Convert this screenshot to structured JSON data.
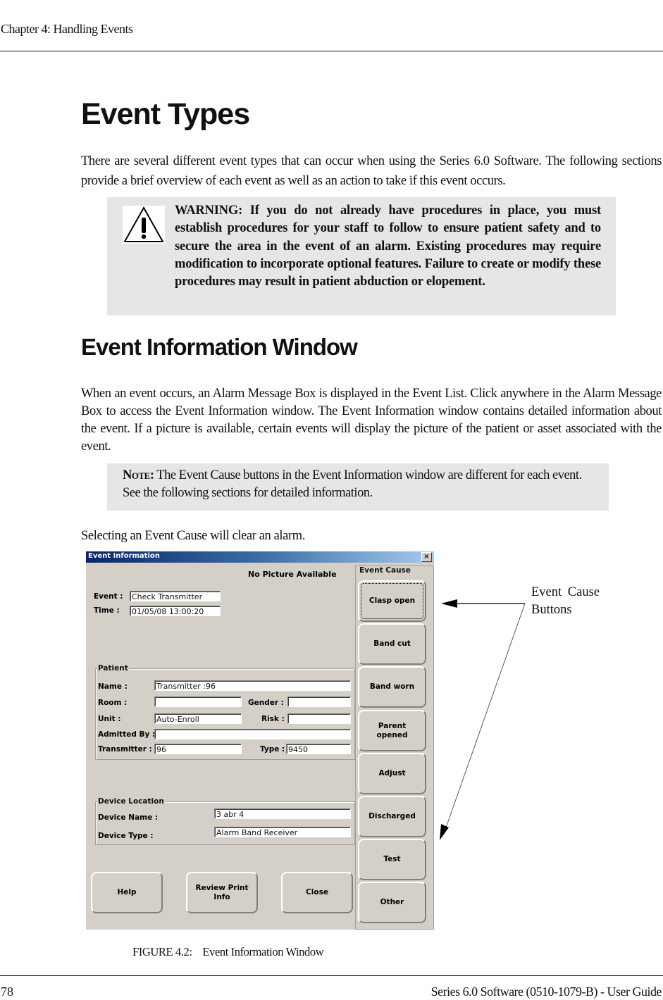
{
  "page": {
    "header": "Chapter 4: Handling Events",
    "title": "Event Types",
    "intro": "There are several different event types that can occur when using the Series 6.0 Software. The following sections provide a brief overview of each event as well as an action to take if this event occurs.",
    "warning": {
      "icon": "warning-triangle-icon",
      "text": "WARNING: If you do not already have procedures in place, you must establish procedures for your staff to follow to ensure patient safety and to secure the area in the event of an alarm. Existing procedures may require modification to incorporate optional features. Failure to create or modify these procedures may result in patient abduction or elopement."
    },
    "section_title": "Event Information Window",
    "section_body": "When an event occurs, an Alarm Message Box is displayed in the Event List. Click anywhere in the Alarm Message Box to access the Event Information window. The Event Information window contains detailed information about the event. If a picture is available, certain events will display the picture of the patient or asset associated with the event.",
    "note": {
      "label": "Note:",
      "text": " The Event Cause buttons in the Event Information window are different for each event. See the following sections for detailed information."
    },
    "clear_text": "Selecting an Event Cause will clear an alarm.",
    "callout": "Event Cause Buttons",
    "caption": "FIGURE 4.2:    Event Information Window",
    "footer_page": "78",
    "footer_title": "Series 6.0 Software (0510-1079-B) - User Guide"
  },
  "dialog": {
    "title": "Event Information",
    "close_glyph": "×",
    "picture_text": "No Picture Available",
    "event_label": "Event :",
    "event_value": "Check Transmitter",
    "time_label": "Time :",
    "time_value": "01/05/08 13:00:20",
    "patient": {
      "group_label": "Patient",
      "name_label": "Name :",
      "name_value": "Transmitter :96",
      "room_label": "Room :",
      "room_value": "",
      "gender_label": "Gender :",
      "gender_value": "",
      "unit_label": "Unit :",
      "unit_value": "Auto-Enroll",
      "risk_label": "Risk :",
      "risk_value": "",
      "admitted_label": "Admitted By :",
      "admitted_value": "",
      "transmitter_label": "Transmitter :",
      "transmitter_value": "96",
      "type_label": "Type :",
      "type_value": "9450"
    },
    "device": {
      "group_label": "Device Location",
      "name_label": "Device Name :",
      "name_value": "3 abr 4",
      "type_label": "Device Type :",
      "type_value": "Alarm Band Receiver"
    },
    "bottom_buttons": {
      "help": "Help",
      "review_line1": "Review Print",
      "review_line2": "Info",
      "close": "Close"
    },
    "cause_group_label": "Event Cause",
    "cause_buttons": [
      {
        "line1": "Clasp open",
        "line2": ""
      },
      {
        "line1": "Band cut",
        "line2": ""
      },
      {
        "line1": "Band worn",
        "line2": ""
      },
      {
        "line1": "Parent",
        "line2": "opened"
      },
      {
        "line1": "Adjust",
        "line2": ""
      },
      {
        "line1": "Discharged",
        "line2": ""
      },
      {
        "line1": "Test",
        "line2": ""
      },
      {
        "line1": "Other",
        "line2": ""
      }
    ]
  }
}
